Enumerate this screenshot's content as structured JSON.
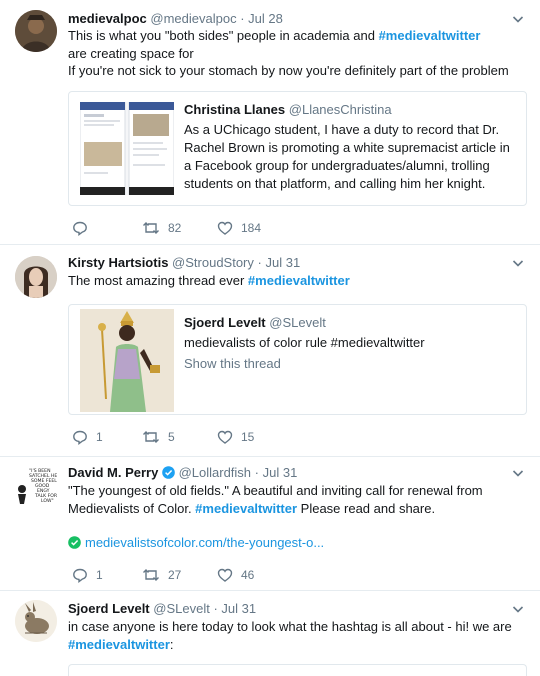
{
  "tweets": [
    {
      "name": "medievalpoc",
      "handle": "@medievalpoc",
      "time": "Jul 28",
      "text_pre": "This is what you \"both sides\" people in academia and ",
      "hashtag": "#medievaltwitter",
      "text_post": " are creating space for",
      "line2": "If you're not sick to your stomach by now you're definitely part of the problem",
      "quote": {
        "name": "Christina Llanes",
        "handle": "@LlanesChristina",
        "text": "As a UChicago student, I have a duty to record that Dr. Rachel Brown is promoting a white supremacist article in a Facebook group for undergraduates/alumni, trolling students on that platform, and calling him her knight."
      },
      "reply_count": "",
      "retweet_count": "82",
      "like_count": "184"
    },
    {
      "name": "Kirsty Hartsiotis",
      "handle": "@StroudStory",
      "time": "Jul 31",
      "text_pre": "The most amazing thread ever ",
      "hashtag": "#medievaltwitter",
      "quote": {
        "name": "Sjoerd Levelt",
        "handle": "@SLevelt",
        "text": "medievalists of color rule #medievaltwitter",
        "show_thread": "Show this thread"
      },
      "reply_count": "1",
      "retweet_count": "5",
      "like_count": "15"
    },
    {
      "name": "David M. Perry",
      "handle": "@Lollardfish",
      "time": "Jul 31",
      "line1": "\"The youngest of old fields.\" A beautiful and inviting call for renewal from",
      "text_pre": "Medievalists of Color. ",
      "hashtag": "#medievaltwitter",
      "text_post": " Please read and share.",
      "link": "medievalistsofcolor.com/the-youngest-o...",
      "reply_count": "1",
      "retweet_count": "27",
      "like_count": "46"
    },
    {
      "name": "Sjoerd Levelt",
      "handle": "@SLevelt",
      "time": "Jul 31",
      "line1": "in case anyone is here today to look what the hashtag is all about - hi! we are",
      "hashtag": "#medievaltwitter",
      "text_post": ":"
    }
  ],
  "separator": "·",
  "avatar_scribble_text": "\"I'S BEEN SATCHEL HER SOME FEEL GOOD ENGY TALK FOR LOW\"",
  "colors": {
    "accent": "#1b95e0",
    "muted": "#657786",
    "border": "#e6ecf0",
    "verified": "#1da1f2",
    "link_ok": "#17bf63"
  },
  "icons": [
    "reply-icon",
    "retweet-icon",
    "like-icon",
    "chevron-down-icon",
    "verified-badge-icon",
    "link-check-icon"
  ]
}
